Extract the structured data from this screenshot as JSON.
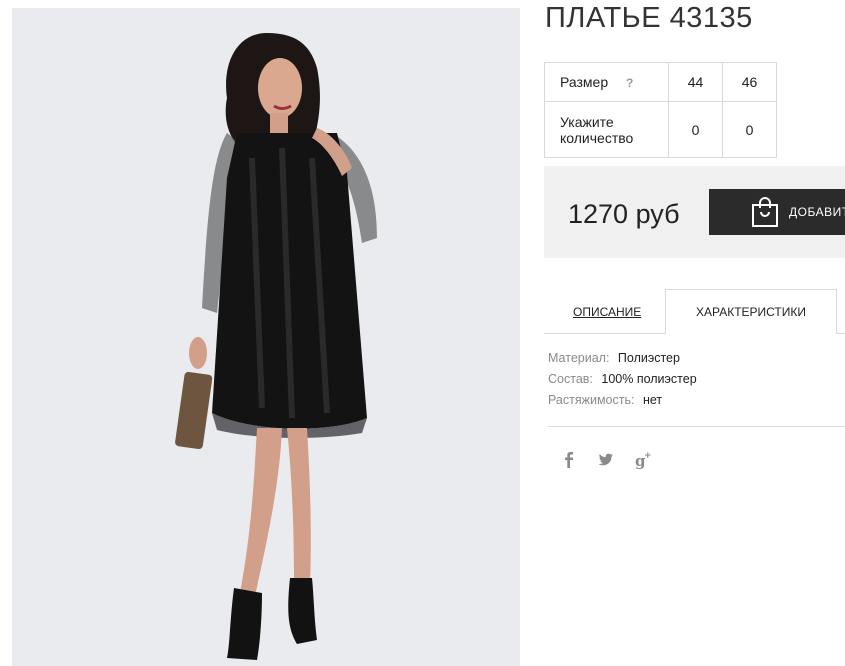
{
  "product": {
    "title": "ПЛАТЬЕ 43135",
    "price": "1270 руб",
    "add_button_label": "ДОБАВИТ"
  },
  "sizes": {
    "row_label": "Размер",
    "help_label": "?",
    "qty_label": "Укажите количество",
    "columns": [
      {
        "size": "44",
        "qty": "0"
      },
      {
        "size": "46",
        "qty": "0"
      }
    ]
  },
  "tabs": {
    "description": "ОПИСАНИЕ",
    "characteristics": "ХАРАКТЕРИСТИКИ"
  },
  "characteristics": [
    {
      "key": "Материал:",
      "value": "Полиэстер"
    },
    {
      "key": "Состав:",
      "value": "100% полиэстер"
    },
    {
      "key": "Растяжимость:",
      "value": "нет"
    }
  ],
  "social": [
    "facebook-icon",
    "twitter-icon",
    "google-plus-icon"
  ],
  "colors": {
    "button_bg": "#2b2b2b",
    "price_bar_bg": "#f0f0f0",
    "photo_bg": "#e9ebee"
  }
}
